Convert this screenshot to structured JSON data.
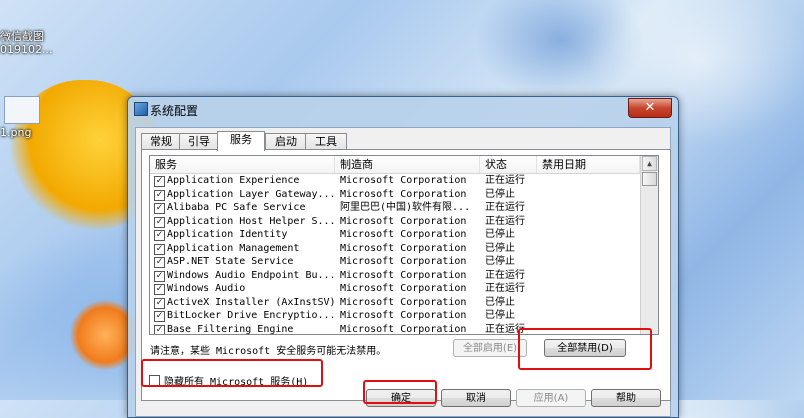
{
  "desktop": {
    "icons": [
      {
        "label_line1": "微信截图",
        "label_line2": "019102..."
      },
      {
        "label_line1": "1.png"
      }
    ]
  },
  "dialog": {
    "title": "系统配置",
    "close_symbol": "✕",
    "tabs": [
      {
        "label": "常规"
      },
      {
        "label": "引导"
      },
      {
        "label": "服务",
        "active": true
      },
      {
        "label": "启动"
      },
      {
        "label": "工具"
      }
    ],
    "services_table": {
      "columns": [
        "服务",
        "制造商",
        "状态",
        "禁用日期"
      ],
      "rows": [
        {
          "checked": true,
          "name": "Application Experience",
          "vendor": "Microsoft Corporation",
          "status": "正在运行"
        },
        {
          "checked": true,
          "name": "Application Layer Gateway...",
          "vendor": "Microsoft Corporation",
          "status": "已停止"
        },
        {
          "checked": true,
          "name": "Alibaba PC Safe Service",
          "vendor": "阿里巴巴(中国)软件有限...",
          "status": "正在运行"
        },
        {
          "checked": true,
          "name": "Application Host Helper S...",
          "vendor": "Microsoft Corporation",
          "status": "正在运行"
        },
        {
          "checked": true,
          "name": "Application Identity",
          "vendor": "Microsoft Corporation",
          "status": "已停止"
        },
        {
          "checked": true,
          "name": "Application Management",
          "vendor": "Microsoft Corporation",
          "status": "已停止"
        },
        {
          "checked": true,
          "name": "ASP.NET State Service",
          "vendor": "Microsoft Corporation",
          "status": "已停止"
        },
        {
          "checked": true,
          "name": "Windows Audio Endpoint Bu...",
          "vendor": "Microsoft Corporation",
          "status": "正在运行"
        },
        {
          "checked": true,
          "name": "Windows Audio",
          "vendor": "Microsoft Corporation",
          "status": "正在运行"
        },
        {
          "checked": true,
          "name": "ActiveX Installer (AxInstSV)",
          "vendor": "Microsoft Corporation",
          "status": "已停止"
        },
        {
          "checked": true,
          "name": "BitLocker Drive Encryptio...",
          "vendor": "Microsoft Corporation",
          "status": "已停止"
        },
        {
          "checked": true,
          "name": "Base Filtering Engine",
          "vendor": "Microsoft Corporation",
          "status": "正在运行"
        }
      ]
    },
    "note": "请注意，某些 Microsoft 安全服务可能无法禁用。",
    "enable_all_label": "全部启用(E)",
    "disable_all_label": "全部禁用(D)",
    "hide_ms_label": "隐藏所有 Microsoft 服务(H)",
    "ok_label": "确定",
    "cancel_label": "取消",
    "apply_label": "应用(A)",
    "help_label": "帮助",
    "highlight_color": "#e01010"
  }
}
